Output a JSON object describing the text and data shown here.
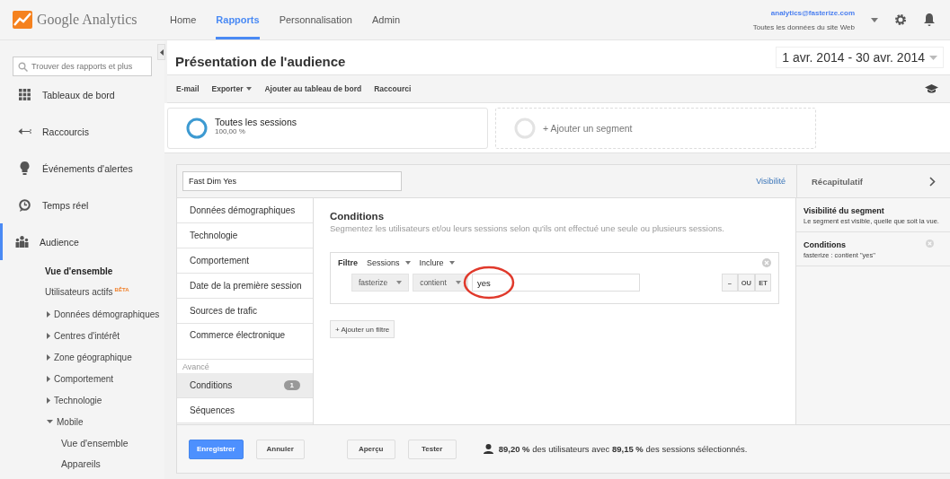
{
  "header": {
    "logo": "Google Analytics",
    "tabs": [
      {
        "label": "Home",
        "selected": false
      },
      {
        "label": "Rapports",
        "selected": true
      },
      {
        "label": "Personnalisation",
        "selected": false
      },
      {
        "label": "Admin",
        "selected": false
      }
    ],
    "account": "analytics@fasterize.com",
    "property": "Toutes les données du site Web"
  },
  "sidebar": {
    "search_placeholder": "Trouver des rapports et plus",
    "items": [
      {
        "label": "Tableaux de bord",
        "selected": false
      },
      {
        "label": "Raccourcis",
        "selected": false
      },
      {
        "label": "Événements d'alertes",
        "selected": false
      },
      {
        "label": "Temps réel",
        "selected": false
      },
      {
        "label": "Audience",
        "selected": true,
        "children": [
          {
            "label": "Vue d'ensemble",
            "selected": true
          },
          {
            "label": "Utilisateurs actifs",
            "badge": "BÊTA",
            "selected": false
          },
          {
            "label": "Données démographiques",
            "expanded": false,
            "selected": false
          },
          {
            "label": "Centres d'intérêt",
            "expanded": false,
            "selected": false
          },
          {
            "label": "Zone géographique",
            "expanded": false,
            "selected": false
          },
          {
            "label": "Comportement",
            "expanded": false,
            "selected": false
          },
          {
            "label": "Technologie",
            "expanded": false,
            "selected": false
          },
          {
            "label": "Mobile",
            "expanded": true,
            "selected": false,
            "children": [
              {
                "label": "Vue d'ensemble",
                "selected": false
              },
              {
                "label": "Appareils",
                "selected": false
              }
            ]
          }
        ]
      }
    ]
  },
  "page": {
    "title": "Présentation de l'audience",
    "date_range": "1 avr. 2014 - 30 avr. 2014",
    "toolbar": [
      {
        "label": "E-mail",
        "dropdown": false
      },
      {
        "label": "Exporter",
        "dropdown": true
      },
      {
        "label": "Ajouter au tableau de bord",
        "dropdown": false
      },
      {
        "label": "Raccourci",
        "dropdown": false
      }
    ],
    "segments": [
      {
        "kind": "active",
        "label": "Toutes les sessions",
        "share": "100,00 %"
      },
      {
        "kind": "add",
        "label": "+ Ajouter un segment"
      }
    ]
  },
  "editor": {
    "name": "Fast Dim Yes",
    "visibility_link": "Visibilité",
    "categories": [
      {
        "label": "Données démographiques",
        "selected": false
      },
      {
        "label": "Technologie",
        "selected": false
      },
      {
        "label": "Comportement",
        "selected": false
      },
      {
        "label": "Date de la première session",
        "selected": false
      },
      {
        "label": "Sources de trafic",
        "selected": false
      },
      {
        "label": "Commerce électronique",
        "selected": false
      }
    ],
    "advanced": {
      "heading": "Avancé",
      "items": [
        {
          "label": "Conditions",
          "count": "1",
          "selected": true
        },
        {
          "label": "Séquences",
          "selected": false
        }
      ]
    },
    "conditions": {
      "title": "Conditions",
      "description": "Segmentez les utilisateurs et/ou leurs sessions selon qu'ils ont effectué une seule ou plusieurs sessions.",
      "filter": {
        "label": "Filtre",
        "scope": "Sessions",
        "mode": "Inclure",
        "dimension": "fasterize",
        "operator": "contient",
        "value": "yes",
        "value_circled": true,
        "buttons": [
          "–",
          "OU",
          "ET"
        ]
      },
      "add_filter": "+ Ajouter un filtre"
    },
    "summary": {
      "title": "Récapitulatif",
      "sections": [
        {
          "title": "Visibilité du segment",
          "text": "Le segment est visible, quelle que soit la vue.",
          "removable": false
        },
        {
          "title": "Conditions",
          "text": "fasterize : contient \"yes\"",
          "removable": true
        }
      ]
    },
    "footer": {
      "buttons": [
        {
          "label": "Enregistrer",
          "kind": "primary"
        },
        {
          "label": "Annuler",
          "kind": "plain"
        },
        {
          "label": "Aperçu",
          "kind": "plain"
        },
        {
          "label": "Tester",
          "kind": "plain"
        }
      ],
      "stats": "**89,20 %** des utilisateurs avec **89,15 %** des sessions sélectionnés."
    }
  }
}
